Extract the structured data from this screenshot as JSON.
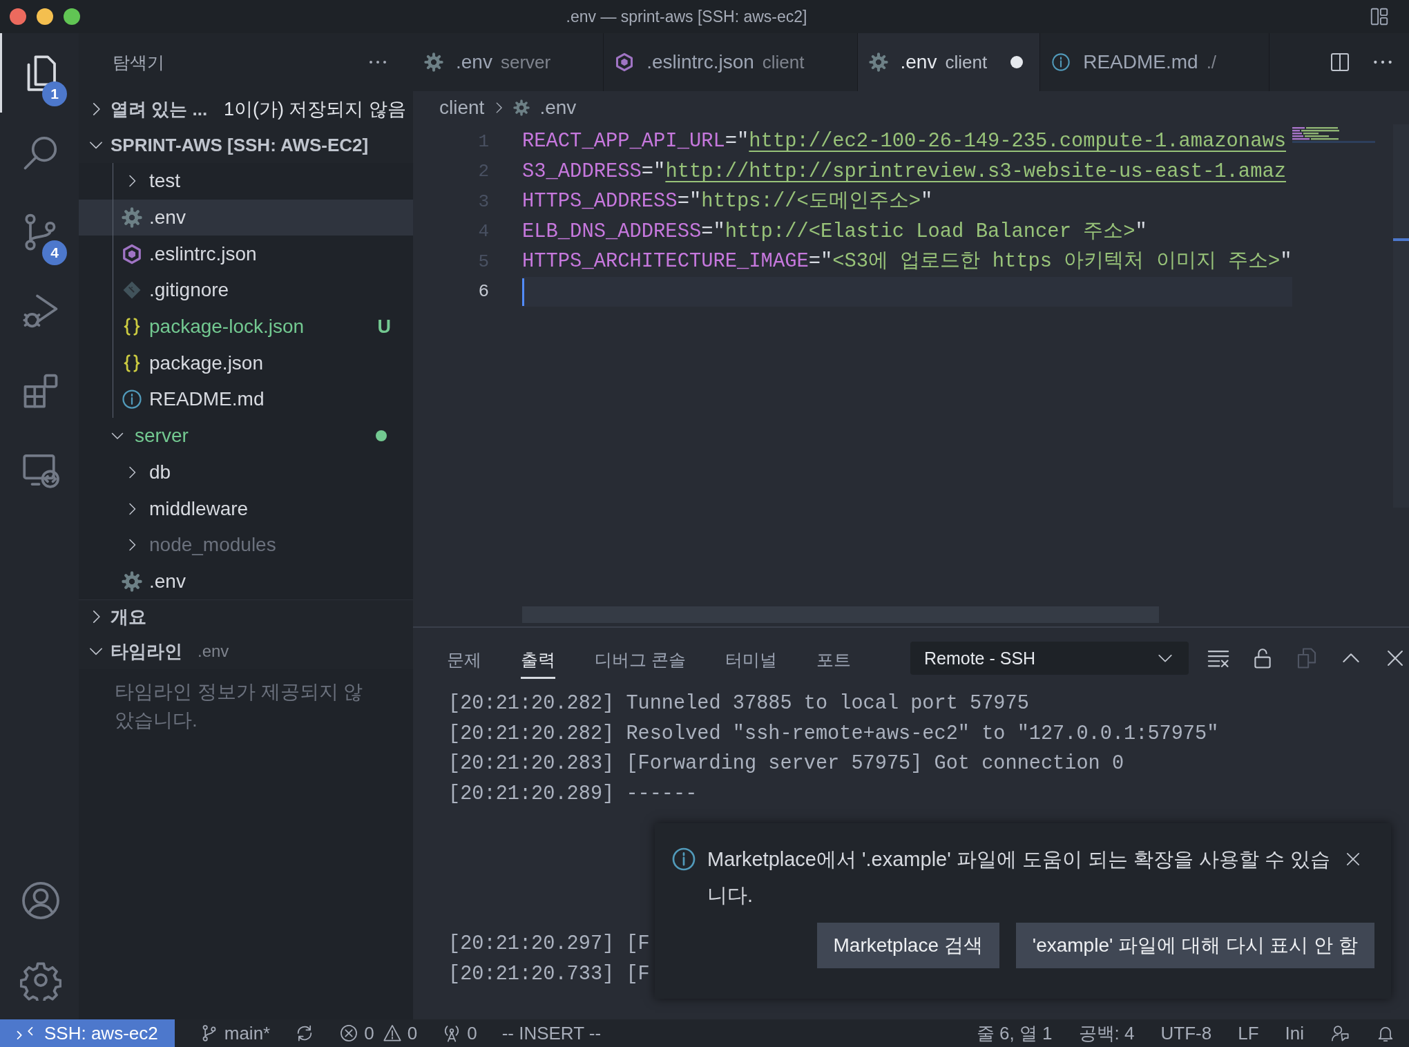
{
  "window": {
    "title": ".env — sprint-aws [SSH: aws-ec2]"
  },
  "activity_bar": {
    "items": [
      {
        "kind": "files",
        "selected": true,
        "badge": "1"
      },
      {
        "kind": "search",
        "selected": false
      },
      {
        "kind": "scm",
        "selected": false,
        "badge": "4"
      },
      {
        "kind": "debug",
        "selected": false
      },
      {
        "kind": "extensions",
        "selected": false
      },
      {
        "kind": "remote",
        "selected": false
      }
    ],
    "bottom": [
      {
        "kind": "account"
      },
      {
        "kind": "settings"
      }
    ]
  },
  "sidebar": {
    "title": "탐색기",
    "open_editors": {
      "title": "열려 있는 ...",
      "expanded": false,
      "note": "1이(가) 저장되지 않음"
    },
    "project": {
      "title": "SPRINT-AWS [SSH: AWS-EC2]",
      "expanded": true,
      "tree": [
        {
          "children": [
            {
              "label": "test",
              "kind": "folder",
              "expanded": false,
              "selected": false
            },
            {
              "label": ".env",
              "kind": "env",
              "selected": true
            },
            {
              "label": ".eslintrc.json",
              "kind": "eslint",
              "selected": false
            },
            {
              "label": ".gitignore",
              "kind": "git",
              "selected": false
            },
            {
              "label": "package-lock.json",
              "kind": "json",
              "selected": false,
              "color": "#73c991",
              "badge": "U"
            },
            {
              "label": "package.json",
              "kind": "json",
              "selected": false
            },
            {
              "label": "README.md",
              "kind": "info",
              "selected": false
            }
          ]
        },
        {
          "label": "server",
          "kind": "folder",
          "expanded": true,
          "selected": false,
          "color": "#73c991",
          "dot": true,
          "children": [
            {
              "label": "db",
              "kind": "folder",
              "expanded": false,
              "selected": false
            },
            {
              "label": "middleware",
              "kind": "folder",
              "expanded": false,
              "selected": false
            },
            {
              "label": "node_modules",
              "kind": "folder",
              "expanded": false,
              "selected": false,
              "dimmed": true
            },
            {
              "label": ".env",
              "kind": "env",
              "selected": false
            }
          ]
        }
      ]
    },
    "outline": {
      "title": "개요",
      "expanded": false
    },
    "timeline": {
      "title": "타임라인",
      "description": ".env",
      "expanded": true,
      "message": "타임라인 정보가 제공되지 않았습니다."
    }
  },
  "editor": {
    "tabs": [
      {
        "label": ".env",
        "description": "server",
        "kind": "env",
        "selected": false,
        "dirty": false
      },
      {
        "label": ".eslintrc.json",
        "description": "client",
        "kind": "eslint",
        "selected": false,
        "dirty": false
      },
      {
        "label": ".env",
        "description": "client",
        "kind": "env",
        "selected": true,
        "dirty": true
      },
      {
        "label": "README.md",
        "description": "./",
        "kind": "info",
        "selected": false,
        "dirty": false
      }
    ],
    "breadcrumb": [
      {
        "label": "client",
        "kind": "folder"
      },
      {
        "label": ".env",
        "kind": "env"
      }
    ],
    "lines": [
      {
        "number": "1",
        "current": false,
        "segments": [
          {
            "kind": "key",
            "text": "REACT_APP_API_URL"
          },
          {
            "kind": "punct",
            "text": "=\""
          },
          {
            "kind": "link",
            "text": "http://ec2-100-26-149-235.compute-1.amazonaws"
          }
        ]
      },
      {
        "number": "2",
        "current": false,
        "segments": [
          {
            "kind": "key",
            "text": "S3_ADDRESS"
          },
          {
            "kind": "punct",
            "text": "=\""
          },
          {
            "kind": "link",
            "text": "http://http://sprintreview.s3-website-us-east-1.amaz"
          }
        ]
      },
      {
        "number": "3",
        "current": false,
        "segments": [
          {
            "kind": "key",
            "text": "HTTPS_ADDRESS"
          },
          {
            "kind": "punct",
            "text": "=\""
          },
          {
            "kind": "string",
            "text": "https://<도메인주소>"
          },
          {
            "kind": "punct",
            "text": "\""
          }
        ]
      },
      {
        "number": "4",
        "current": false,
        "segments": [
          {
            "kind": "key",
            "text": "ELB_DNS_ADDRESS"
          },
          {
            "kind": "punct",
            "text": "=\""
          },
          {
            "kind": "string",
            "text": "http://<Elastic Load Balancer 주소>"
          },
          {
            "kind": "punct",
            "text": "\""
          }
        ]
      },
      {
        "number": "5",
        "current": false,
        "segments": [
          {
            "kind": "key",
            "text": "HTTPS_ARCHITECTURE_IMAGE"
          },
          {
            "kind": "punct",
            "text": "=\""
          },
          {
            "kind": "string",
            "text": "<S3에 업로드한 https 아키텍처 이미지 주소>"
          },
          {
            "kind": "punct",
            "text": "\""
          }
        ]
      },
      {
        "number": "6",
        "current": true
      }
    ]
  },
  "panel": {
    "tabs": [
      {
        "label": "문제",
        "selected": false
      },
      {
        "label": "출력",
        "selected": true
      },
      {
        "label": "디버그 콘솔",
        "selected": false
      },
      {
        "label": "터미널",
        "selected": false
      },
      {
        "label": "포트",
        "selected": false
      }
    ],
    "channel": "Remote - SSH",
    "groups": [
      [
        "[20:21:20.282] Tunneled 37885 to local port 57975",
        "[20:21:20.282] Resolved \"ssh-remote+aws-ec2\" to \"127.0.0.1:57975\"",
        "[20:21:20.283] [Forwarding server 57975] Got connection 0",
        "[20:21:20.289] ------"
      ],
      [
        "[20:21:20.297] [F",
        "[20:21:20.733] [F"
      ]
    ]
  },
  "notification": {
    "message": "Marketplace에서 '.example' 파일에 도움이 되는 확장을 사용할 수 있습니다.",
    "buttons": [
      "Marketplace 검색",
      "'example' 파일에 대해 다시 표시 안 함"
    ]
  },
  "status_bar": {
    "left": [
      {
        "kind": "remote",
        "text": "SSH: aws-ec2"
      },
      {
        "kind": "branch",
        "text": "main*"
      },
      {
        "kind": "sync"
      },
      {
        "kind": "problems",
        "errors": "0",
        "warnings": "0"
      },
      {
        "kind": "ports",
        "text": "0"
      },
      {
        "kind": "text",
        "text": "-- INSERT --"
      }
    ],
    "right": [
      {
        "kind": "text",
        "text": "줄 6, 열 1"
      },
      {
        "kind": "text",
        "text": "공백: 4"
      },
      {
        "kind": "text",
        "text": "UTF-8"
      },
      {
        "kind": "text",
        "text": "LF"
      },
      {
        "kind": "text",
        "text": "Ini"
      },
      {
        "kind": "feedback"
      },
      {
        "kind": "bell"
      }
    ]
  }
}
